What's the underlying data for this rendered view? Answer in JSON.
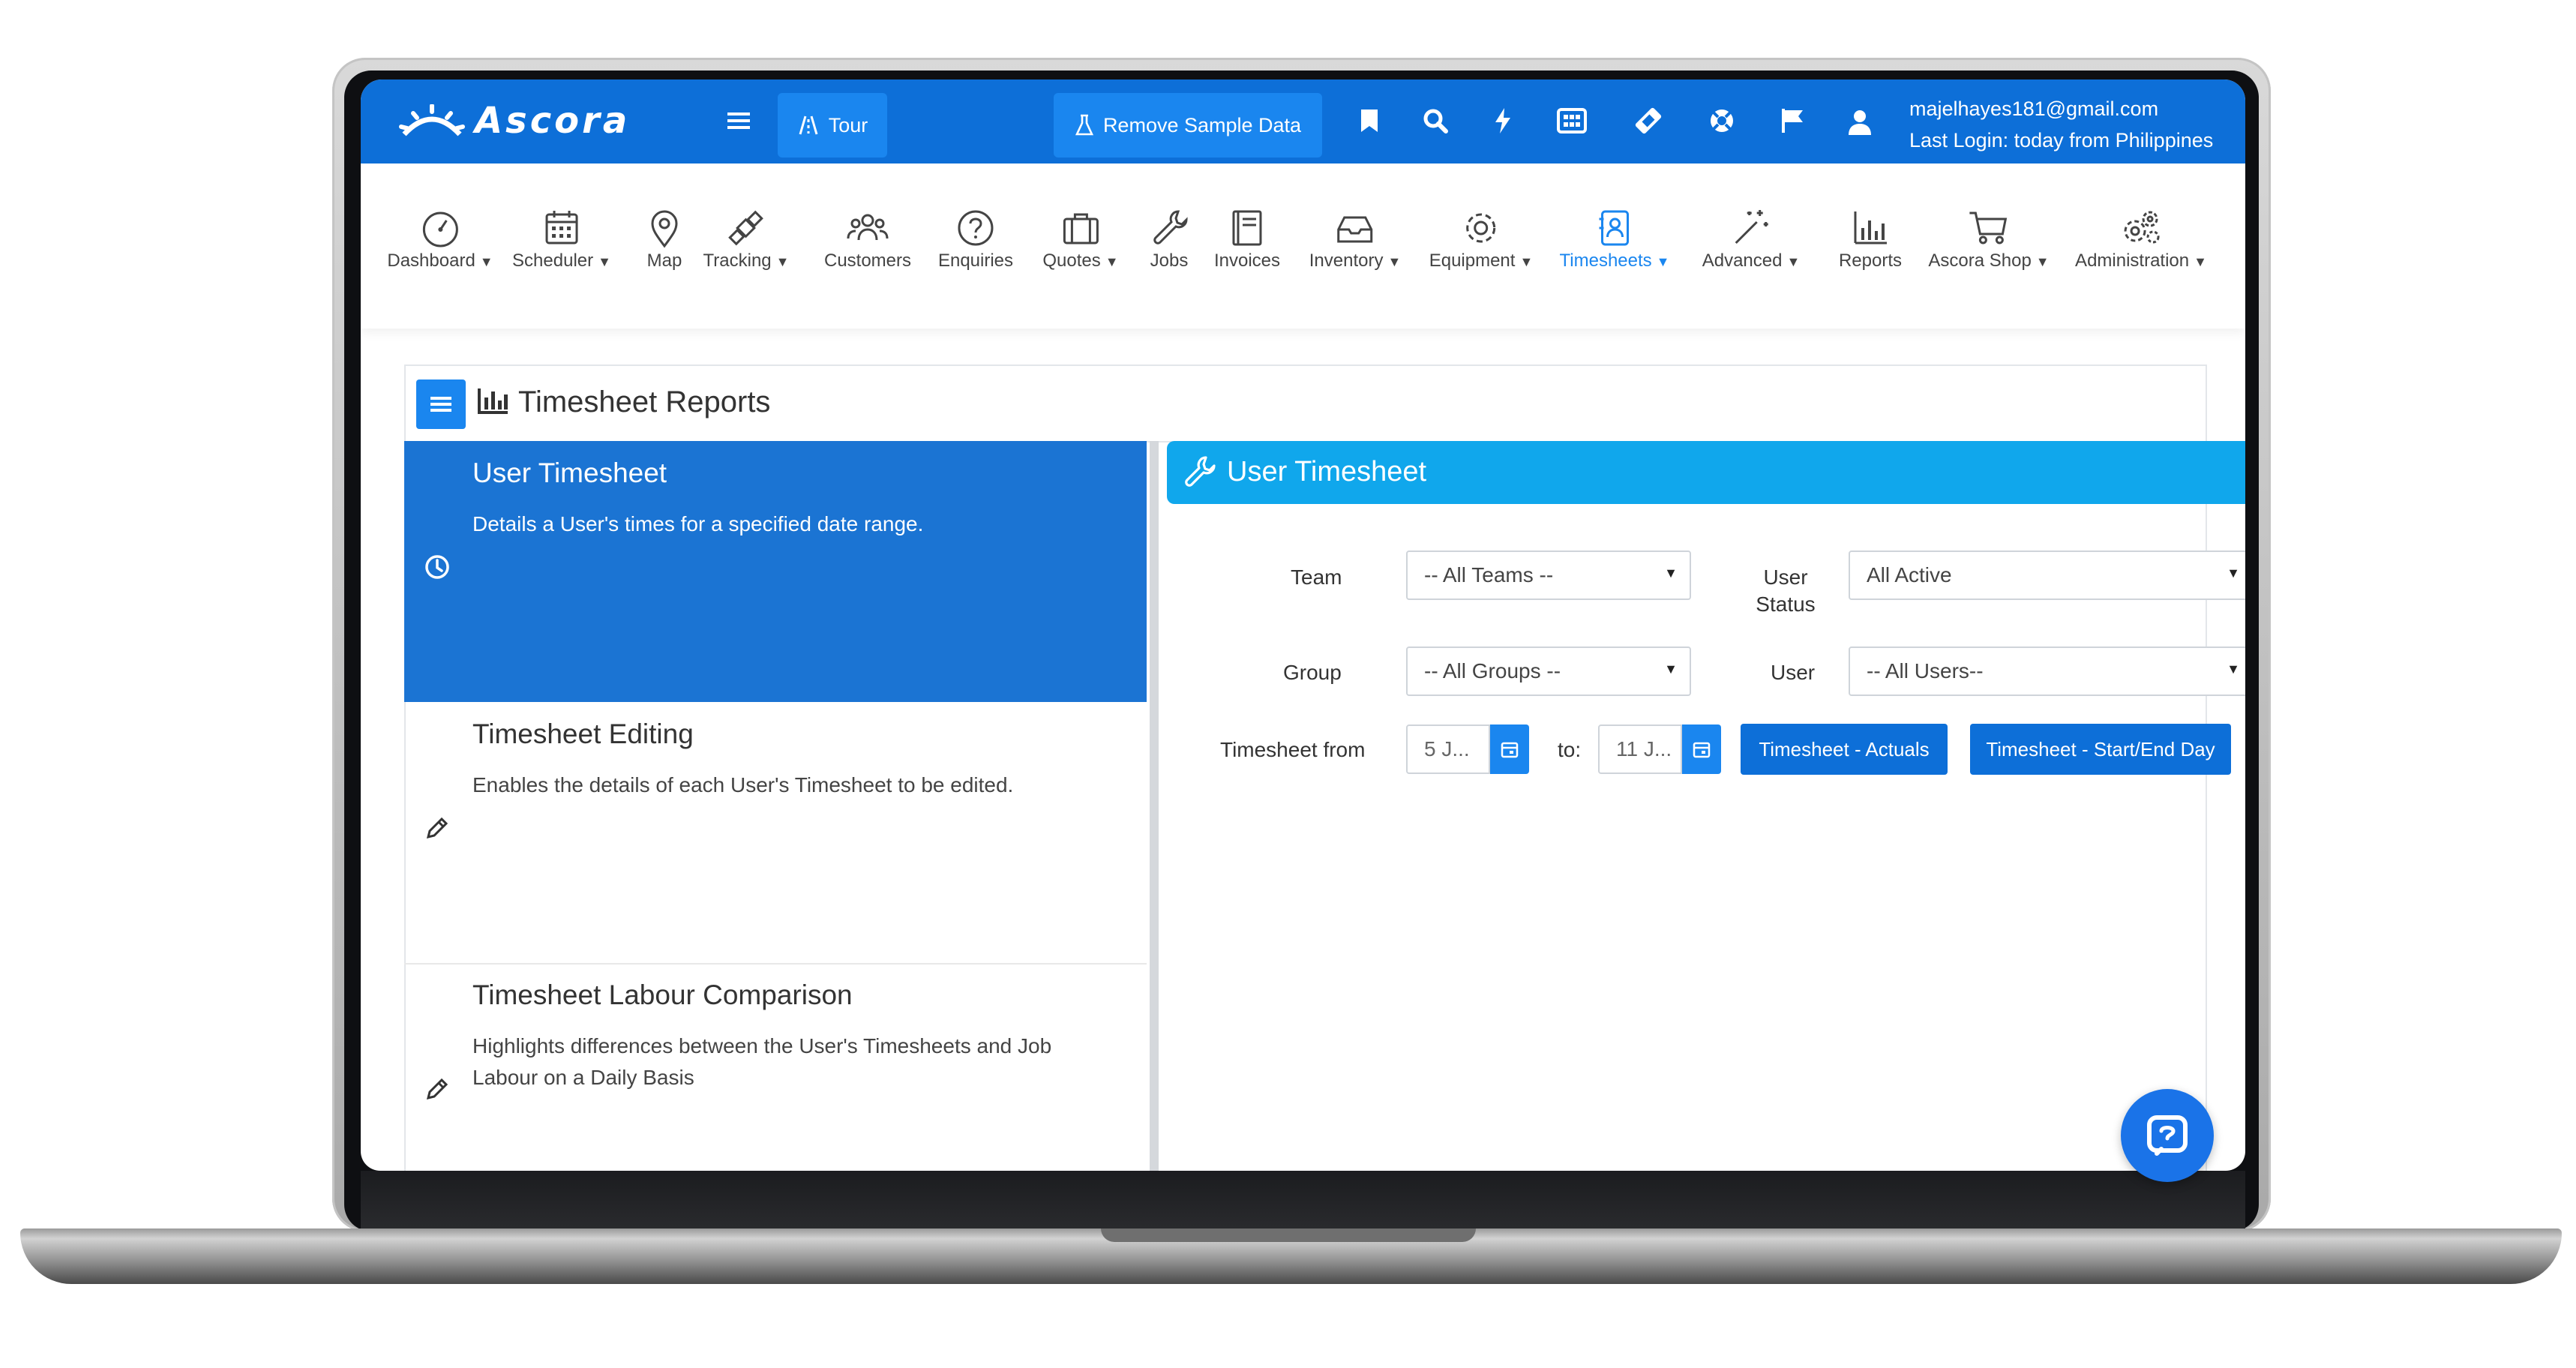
{
  "app": {
    "brand": "Ascora",
    "brand_color": "#0d6fd8",
    "accent_color": "#1a86ef",
    "header_color": "#10a7ec"
  },
  "topbar": {
    "tour_label": "Tour",
    "remove_sample_label": "Remove Sample Data",
    "icons": [
      "menu-icon",
      "bookmark-icon",
      "search-icon",
      "lightning-icon",
      "grid-icon",
      "ticket-icon",
      "lifebuoy-icon",
      "flag-icon",
      "user-icon"
    ],
    "user_email": "majelhayes181@gmail.com",
    "last_login": "Last Login: today from Philippines"
  },
  "nav": {
    "items": [
      {
        "label": "Dashboard",
        "icon": "gauge-icon",
        "dropdown": true
      },
      {
        "label": "Scheduler",
        "icon": "calendar-icon",
        "dropdown": true
      },
      {
        "label": "Map",
        "icon": "map-pin-icon",
        "dropdown": false
      },
      {
        "label": "Tracking",
        "icon": "satellite-icon",
        "dropdown": true
      },
      {
        "label": "Customers",
        "icon": "people-icon",
        "dropdown": false
      },
      {
        "label": "Enquiries",
        "icon": "question-icon",
        "dropdown": false
      },
      {
        "label": "Quotes",
        "icon": "briefcase-icon",
        "dropdown": true
      },
      {
        "label": "Jobs",
        "icon": "wrench-icon",
        "dropdown": false
      },
      {
        "label": "Invoices",
        "icon": "book-icon",
        "dropdown": false
      },
      {
        "label": "Inventory",
        "icon": "inbox-icon",
        "dropdown": true
      },
      {
        "label": "Equipment",
        "icon": "gear-icon",
        "dropdown": true
      },
      {
        "label": "Timesheets",
        "icon": "contact-book-icon",
        "dropdown": true,
        "active": true
      },
      {
        "label": "Advanced",
        "icon": "magic-wand-icon",
        "dropdown": true
      },
      {
        "label": "Reports",
        "icon": "bar-chart-icon",
        "dropdown": false
      },
      {
        "label": "Ascora Shop",
        "icon": "cart-icon",
        "dropdown": true
      },
      {
        "label": "Administration",
        "icon": "gears-icon",
        "dropdown": true
      }
    ]
  },
  "report": {
    "title": "Timesheet Reports",
    "list": [
      {
        "title": "User Timesheet",
        "description": "Details a User's times for a specified date range.",
        "icon": "clock-icon",
        "active": true
      },
      {
        "title": "Timesheet Editing",
        "description": "Enables the details of each User's Timesheet to be edited.",
        "icon": "pencil-icon",
        "active": false
      },
      {
        "title": "Timesheet Labour Comparison",
        "description": "Highlights differences between the User's Timesheets and Job Labour on a Daily Basis",
        "icon": "pencil-icon",
        "active": false
      }
    ]
  },
  "detail": {
    "title": "User Timesheet",
    "team_label": "Team",
    "team_value": "-- All Teams --",
    "user_status_label_1": "User",
    "user_status_label_2": "Status",
    "user_status_value": "All Active",
    "group_label": "Group",
    "group_value": "-- All Groups --",
    "user_label": "User",
    "user_value": "-- All Users--",
    "from_label": "Timesheet from",
    "from_value": "5 J...",
    "to_label": "to:",
    "to_value": "11 J...",
    "actuals_button": "Timesheet - Actuals",
    "startend_button": "Timesheet - Start/End Day"
  }
}
